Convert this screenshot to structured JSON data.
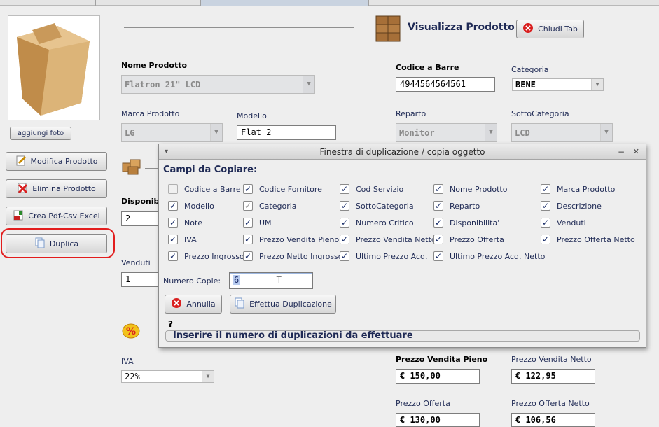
{
  "window": {
    "title": "Visualizza Prodotto",
    "close_tab_label": "Chiudi Tab"
  },
  "sidebar": {
    "add_photo_label": "aggiungi foto",
    "buttons": [
      {
        "label": "Modifica Prodotto",
        "icon": "edit-icon"
      },
      {
        "label": "Elimina Prodotto",
        "icon": "delete-icon"
      },
      {
        "label": "Crea Pdf-Csv Excel",
        "icon": "pdf-icon"
      },
      {
        "label": "Duplica",
        "icon": "copy-icon"
      }
    ]
  },
  "form": {
    "nome_prodotto": {
      "label": "Nome Prodotto",
      "value": "Flatron 21\" LCD"
    },
    "codice_barre": {
      "label": "Codice a Barre",
      "value": "4944564564561"
    },
    "categoria": {
      "label": "Categoria",
      "value": "BENE"
    },
    "marca": {
      "label": "Marca Prodotto",
      "value": "LG"
    },
    "modello": {
      "label": "Modello",
      "value": "Flat 2"
    },
    "reparto": {
      "label": "Reparto",
      "value": "Monitor"
    },
    "sottocategoria": {
      "label": "SottoCategoria",
      "value": "LCD"
    },
    "disponibilita": {
      "label": "Disponibi",
      "value": "2"
    },
    "venduti": {
      "label": "Venduti",
      "value": "1"
    },
    "iva": {
      "label": "IVA",
      "value": "22%"
    },
    "prezzo_vendita_pieno": {
      "label": "Prezzo Vendita Pieno",
      "value": "€ 150,00"
    },
    "prezzo_vendita_netto": {
      "label": "Prezzo Vendita Netto",
      "value": "€ 122,95"
    },
    "prezzo_offerta": {
      "label": "Prezzo Offerta",
      "value": "€ 130,00"
    },
    "prezzo_offerta_netto": {
      "label": "Prezzo Offerta Netto",
      "value": "€ 106,56"
    }
  },
  "dialog": {
    "title": "Finestra di duplicazione / copia oggetto",
    "section_title": "Campi da Copiare:",
    "checkboxes": [
      {
        "label": "Codice a Barre",
        "checked": false
      },
      {
        "label": "Codice Fornitore",
        "checked": true
      },
      {
        "label": "Cod Servizio",
        "checked": true
      },
      {
        "label": "Nome Prodotto",
        "checked": true
      },
      {
        "label": "Marca Prodotto",
        "checked": true
      },
      {
        "label": "Modello",
        "checked": true
      },
      {
        "label": "Categoria",
        "checked": true,
        "disabled": true
      },
      {
        "label": "SottoCategoria",
        "checked": true
      },
      {
        "label": "Reparto",
        "checked": true
      },
      {
        "label": "Descrizione",
        "checked": true
      },
      {
        "label": "Note",
        "checked": true
      },
      {
        "label": "UM",
        "checked": true
      },
      {
        "label": "Numero Critico",
        "checked": true
      },
      {
        "label": "Disponibilita'",
        "checked": true
      },
      {
        "label": "Venduti",
        "checked": true
      },
      {
        "label": "IVA",
        "checked": true
      },
      {
        "label": "Prezzo Vendita Pieno",
        "checked": true
      },
      {
        "label": "Prezzo Vendita Netto",
        "checked": true
      },
      {
        "label": "Prezzo Offerta",
        "checked": true
      },
      {
        "label": "Prezzo Offerta Netto",
        "checked": true
      },
      {
        "label": "Prezzo Ingrosso",
        "checked": true
      },
      {
        "label": "Prezzo Netto Ingrosso",
        "checked": true
      },
      {
        "label": "Ultimo Prezzo Acq.",
        "checked": true
      },
      {
        "label": "Ultimo Prezzo Acq. Netto",
        "checked": true
      }
    ],
    "numero_copie_label": "Numero Copie:",
    "numero_copie_value": "6",
    "cancel_label": "Annulla",
    "confirm_label": "Effettua Duplicazione",
    "help_mark": "?",
    "status_text": "Inserire il numero di duplicazioni da effettuare",
    "minimize_glyph": "−",
    "close_glyph": "✕",
    "menu_glyph": "▾"
  },
  "colors": {
    "accent": "#1f2a55",
    "highlight": "#e21d1d",
    "delete": "#d92020"
  }
}
